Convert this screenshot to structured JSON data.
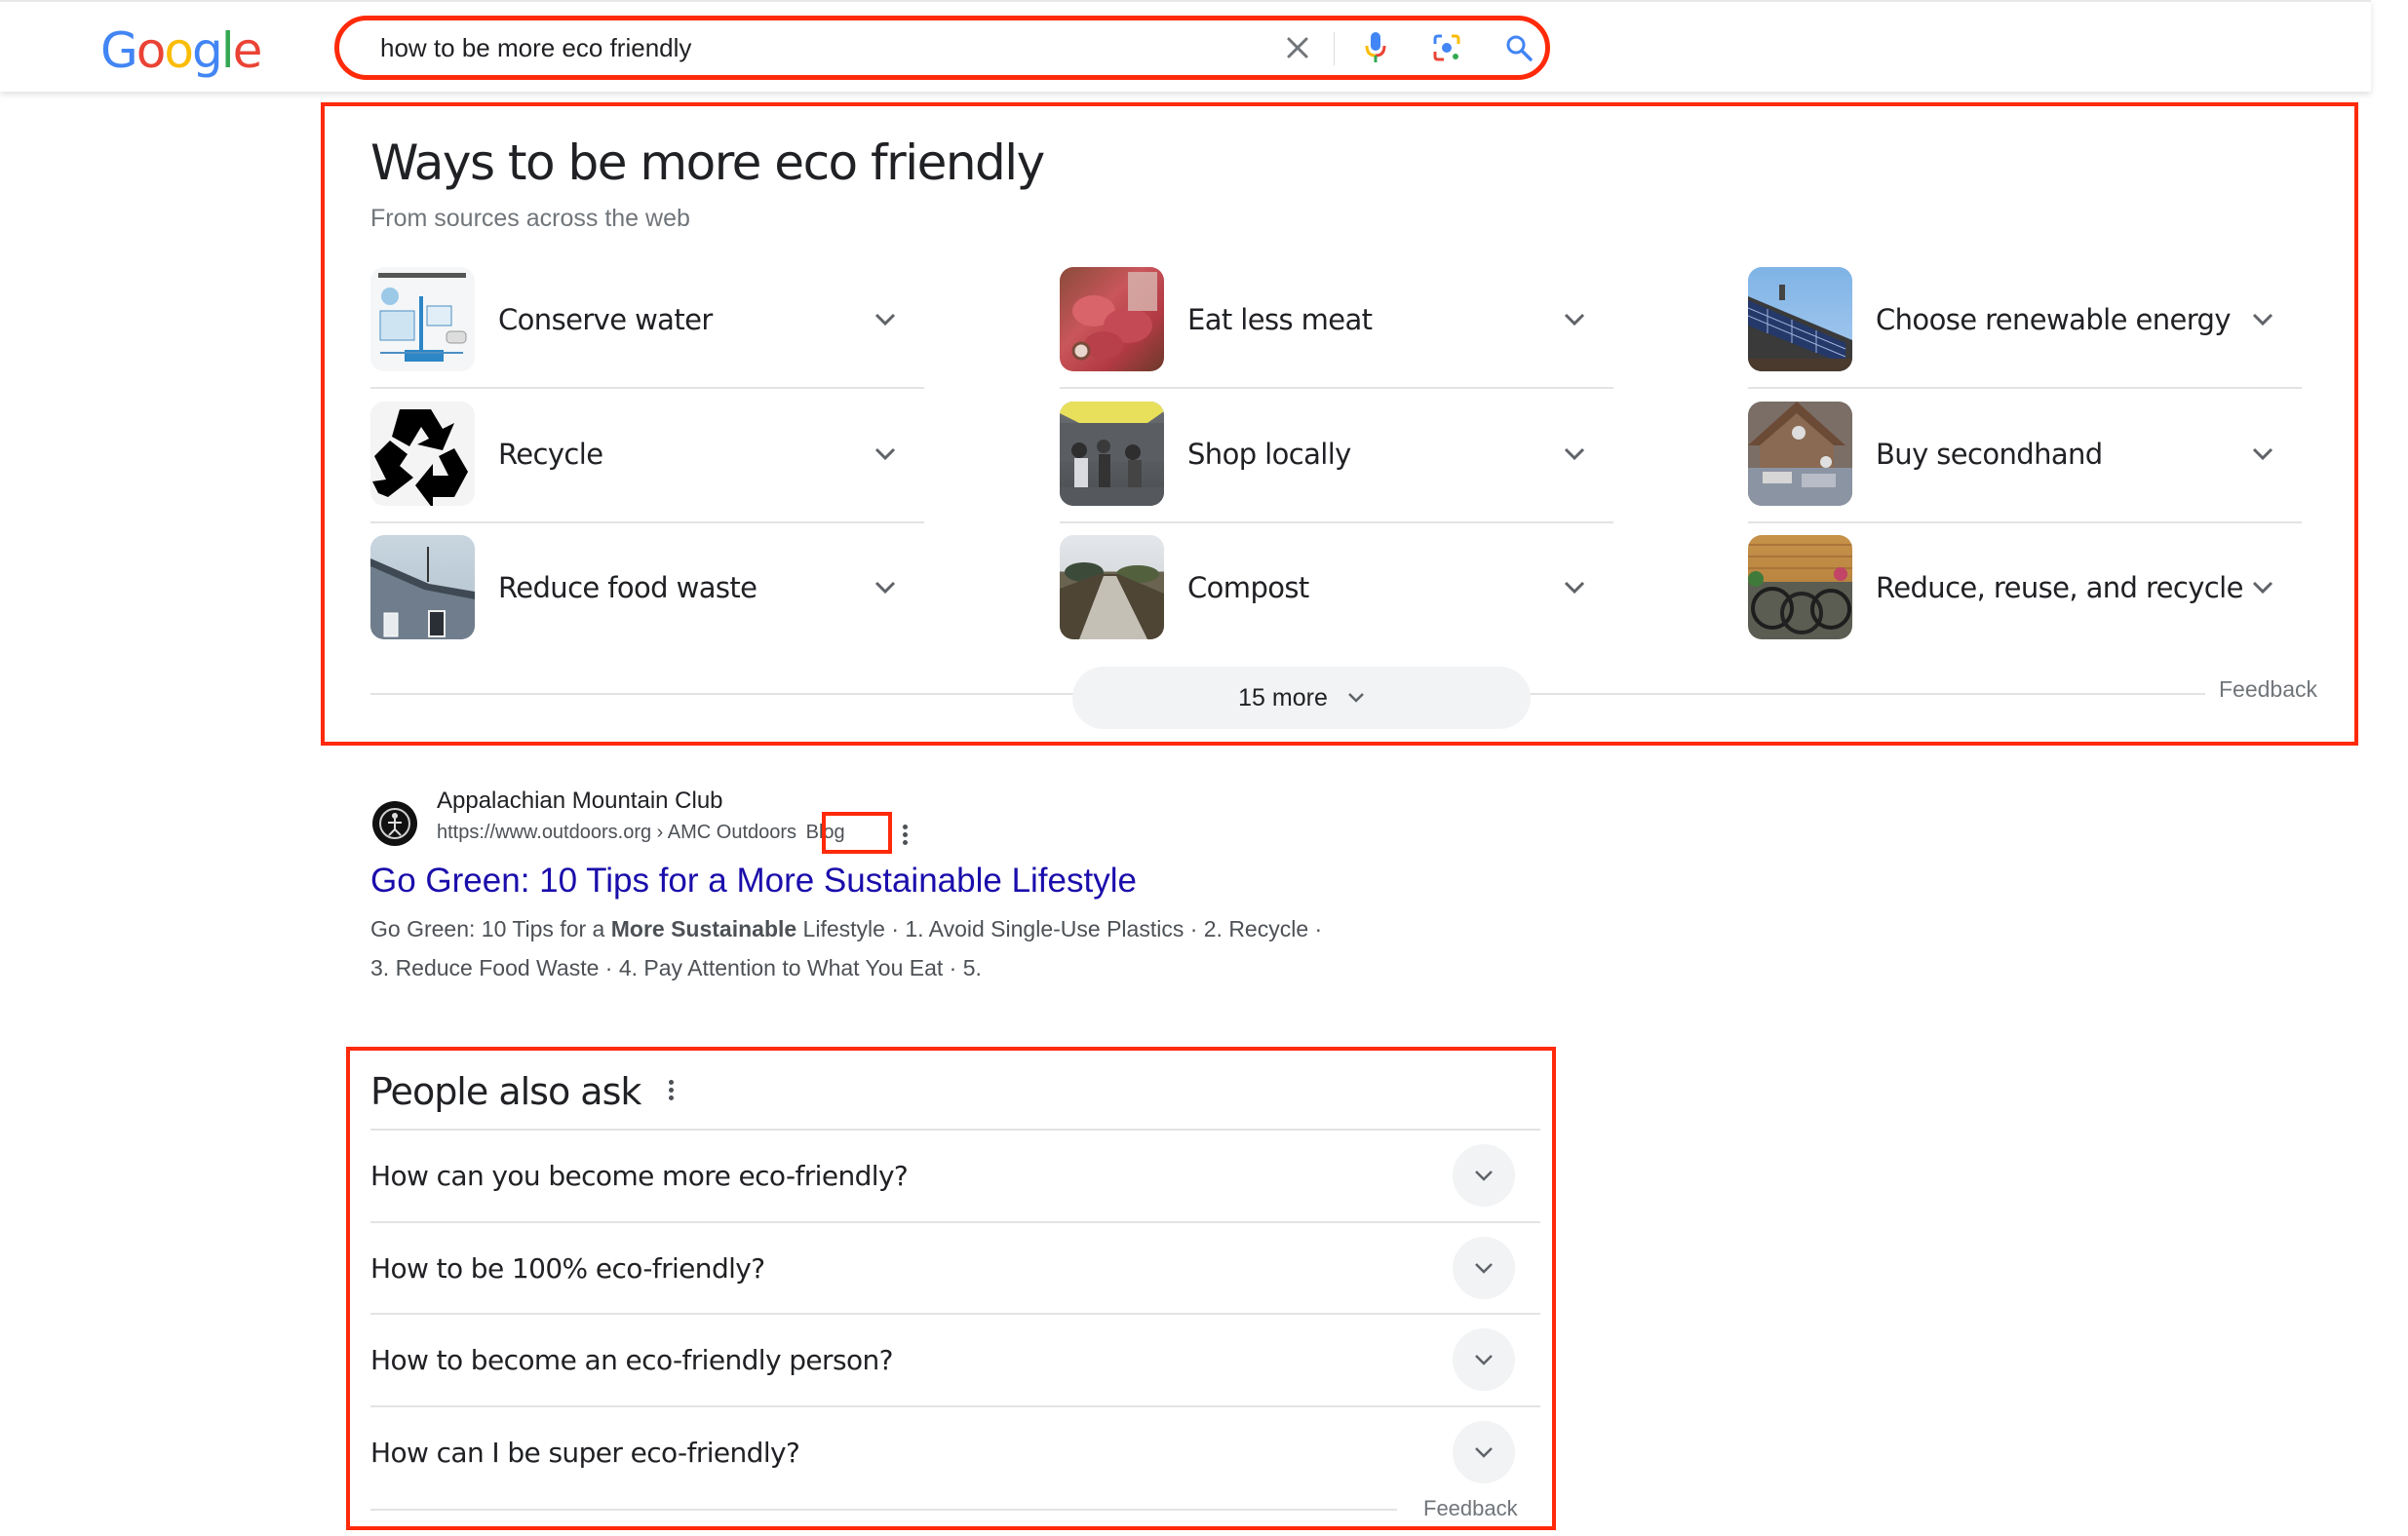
{
  "header": {
    "logo_letters": [
      {
        "char": "G",
        "color": "#4285f4"
      },
      {
        "char": "o",
        "color": "#ea4335"
      },
      {
        "char": "o",
        "color": "#fbbc05"
      },
      {
        "char": "g",
        "color": "#4285f4"
      },
      {
        "char": "l",
        "color": "#34a853"
      },
      {
        "char": "e",
        "color": "#ea4335"
      }
    ],
    "search": {
      "value": "how to be more eco friendly",
      "icons": [
        "clear-icon",
        "microphone-icon",
        "google-lens-icon",
        "search-icon"
      ]
    }
  },
  "ways_card": {
    "title": "Ways to be more eco friendly",
    "subtitle": "From sources across the web",
    "items": [
      {
        "label": "Conserve water",
        "thumb": "rainwater-harvesting-diagram"
      },
      {
        "label": "Eat less meat",
        "thumb": "raw-meat-photo"
      },
      {
        "label": "Choose renewable energy",
        "thumb": "solar-panels-roof-photo"
      },
      {
        "label": "Recycle",
        "thumb": "recycle-symbol"
      },
      {
        "label": "Shop locally",
        "thumb": "farmers-market-photo"
      },
      {
        "label": "Buy secondhand",
        "thumb": "yard-sale-photo"
      },
      {
        "label": "Reduce food waste",
        "thumb": "shingled-house-photo"
      },
      {
        "label": "Compost",
        "thumb": "compost-path-photo"
      },
      {
        "label": "Reduce, reuse, and recycle",
        "thumb": "bicycles-photo"
      }
    ],
    "more_label": "15 more",
    "feedback": "Feedback"
  },
  "result": {
    "site_name": "Appalachian Mountain Club",
    "url_prefix": "https://www.outdoors.org › AMC Outdoors",
    "url_tag": "Blog",
    "title": "Go Green: 10 Tips for a More Sustainable Lifestyle",
    "snippet_line1_pre": "Go Green: 10 Tips for a ",
    "snippet_line1_bold": "More Sustainable",
    "snippet_line1_post": " Lifestyle · 1. Avoid Single-Use Plastics · 2. Recycle ·",
    "snippet_line2": "3. Reduce Food Waste · 4. Pay Attention to What You Eat · 5."
  },
  "paa": {
    "title": "People also ask",
    "questions": [
      "How can you become more eco-friendly?",
      "How to be 100% eco-friendly?",
      "How to become an eco-friendly person?",
      "How can I be super eco-friendly?"
    ],
    "feedback": "Feedback"
  },
  "colors": {
    "annotation_red": "#ff2a0a",
    "link_blue": "#1a0dab",
    "text_gray": "#4d5156"
  }
}
